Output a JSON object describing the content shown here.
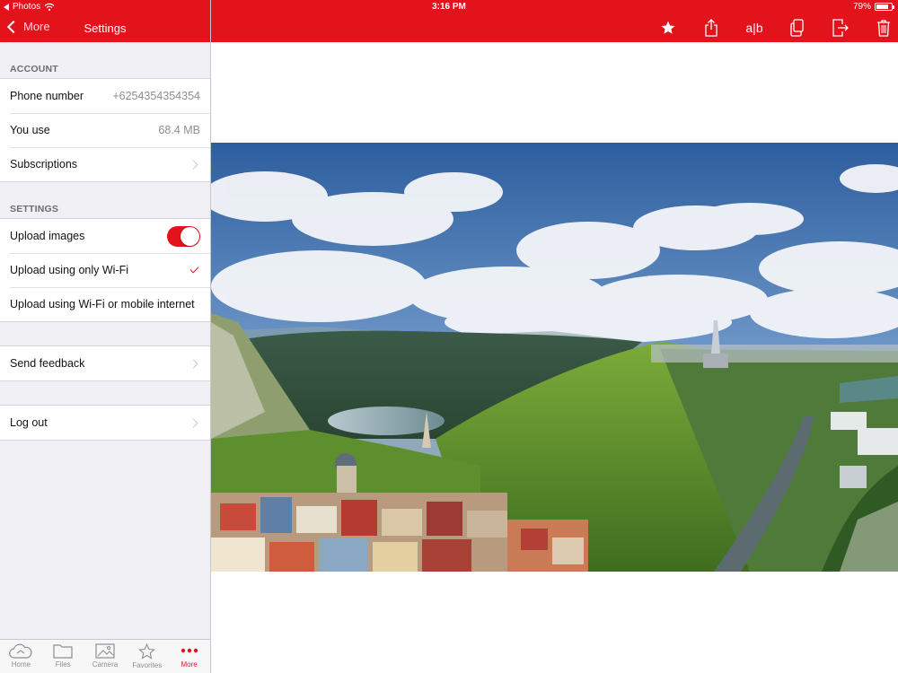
{
  "status": {
    "app_back": "Photos",
    "time": "3:16 PM",
    "battery": "79%",
    "battery_level": 0.79
  },
  "nav": {
    "back_label": "More",
    "title": "Settings"
  },
  "toolbar": {
    "ab_label": "a|b",
    "icons": [
      "star-icon",
      "share-icon",
      "rename-icon",
      "copy-icon",
      "move-icon",
      "trash-icon"
    ]
  },
  "account": {
    "header": "ACCOUNT",
    "phone_label": "Phone number",
    "phone_value": "+6254354354354",
    "use_label": "You use",
    "use_value": "68.4 MB",
    "subscriptions_label": "Subscriptions"
  },
  "settings": {
    "header": "SETTINGS",
    "upload_images_label": "Upload images",
    "upload_images_on": true,
    "wifi_only_label": "Upload using only Wi-Fi",
    "wifi_mobile_label": "Upload using Wi-Fi or mobile internet"
  },
  "feedback_label": "Send feedback",
  "logout_label": "Log out",
  "tabs": [
    {
      "label": "Home",
      "icon": "cloud-icon"
    },
    {
      "label": "Files",
      "icon": "folder-icon"
    },
    {
      "label": "Camera",
      "icon": "image-icon"
    },
    {
      "label": "Favorites",
      "icon": "star-outline-icon"
    },
    {
      "label": "More",
      "icon": "more-dots-icon",
      "active": true
    }
  ],
  "colors": {
    "accent": "#e3131b",
    "sidebar_bg": "#efeff4",
    "secondary_text": "#8e8e93"
  }
}
